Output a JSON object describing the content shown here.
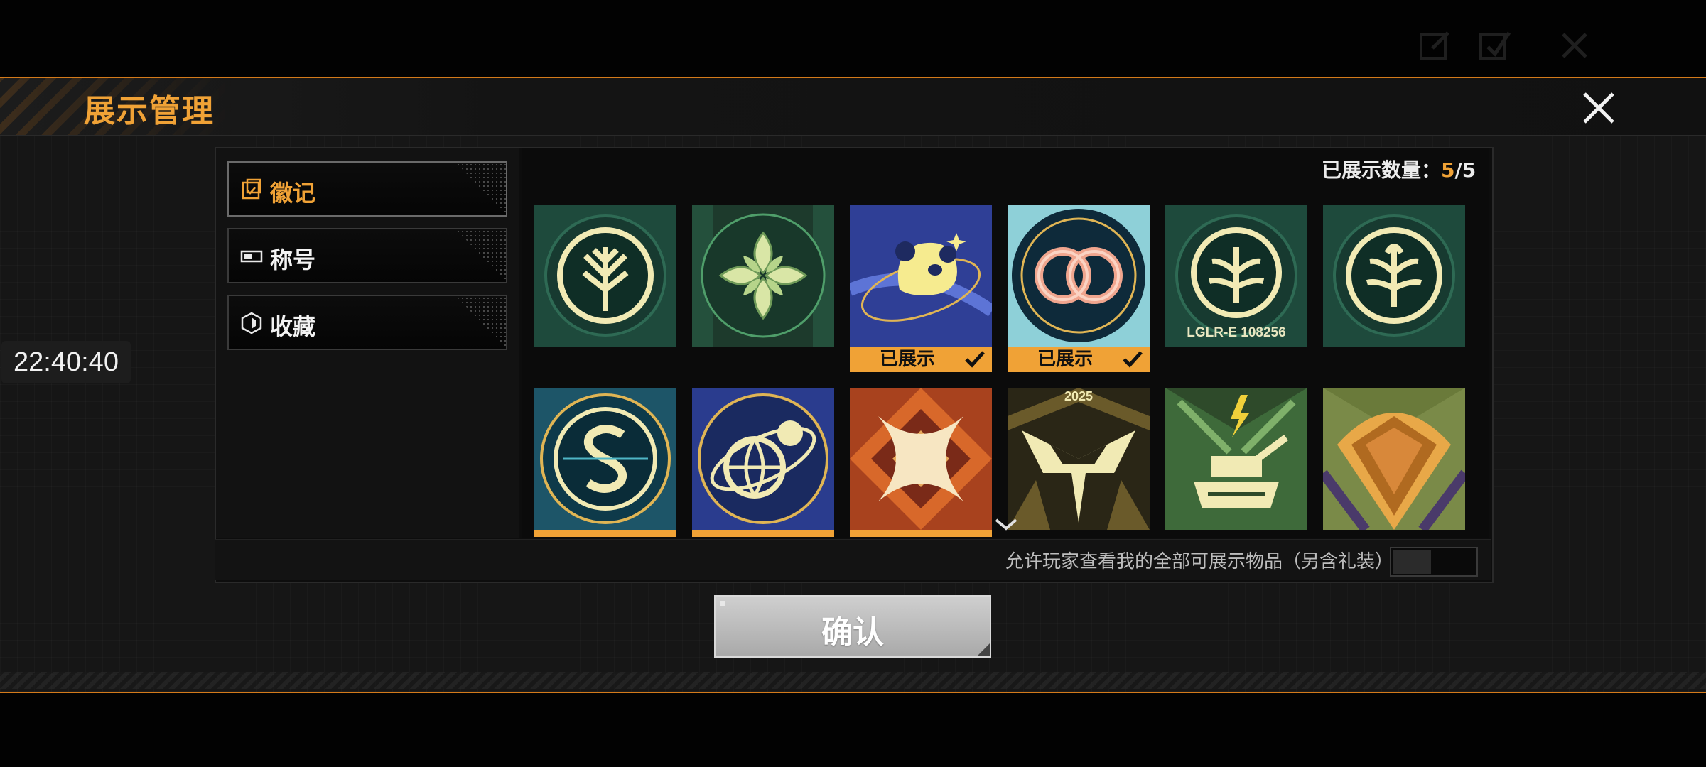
{
  "header": {
    "title": "展示管理"
  },
  "clock": "22:40:40",
  "tabs": [
    {
      "label": "徽记",
      "icon": "badge-icon",
      "active": true
    },
    {
      "label": "称号",
      "icon": "title-card-icon",
      "active": false
    },
    {
      "label": "收藏",
      "icon": "collection-shield-icon",
      "active": false
    }
  ],
  "display_count": {
    "label": "已展示数量：",
    "current": "5",
    "sep": "/",
    "max": "5"
  },
  "shown_label": "已展示",
  "badges": [
    {
      "name": "green-tree-emblem",
      "shown": false
    },
    {
      "name": "leaf-flower-emblem",
      "shown": false
    },
    {
      "name": "panda-emblem",
      "shown": true
    },
    {
      "name": "twin-rings-emblem",
      "shown": true
    },
    {
      "name": "lglr-serial-emblem",
      "shown": false,
      "caption": "LGLR-E 108256"
    },
    {
      "name": "sprout-emblem",
      "shown": false
    },
    {
      "name": "s-globe-emblem",
      "shown": true
    },
    {
      "name": "planet-orbit-emblem",
      "shown": true
    },
    {
      "name": "cross-x-emblem",
      "shown": true
    },
    {
      "name": "year-2025-emblem",
      "shown": false,
      "caption": "2025"
    },
    {
      "name": "tank-emblem",
      "shown": false
    },
    {
      "name": "gold-diamond-emblem",
      "shown": false
    }
  ],
  "allow_text": "允许玩家查看我的全部可展示物品（另含礼装）",
  "confirm_label": "确认",
  "colors": {
    "accent": "#f0a236",
    "panel": "#161616",
    "border": "#d47a1a"
  }
}
